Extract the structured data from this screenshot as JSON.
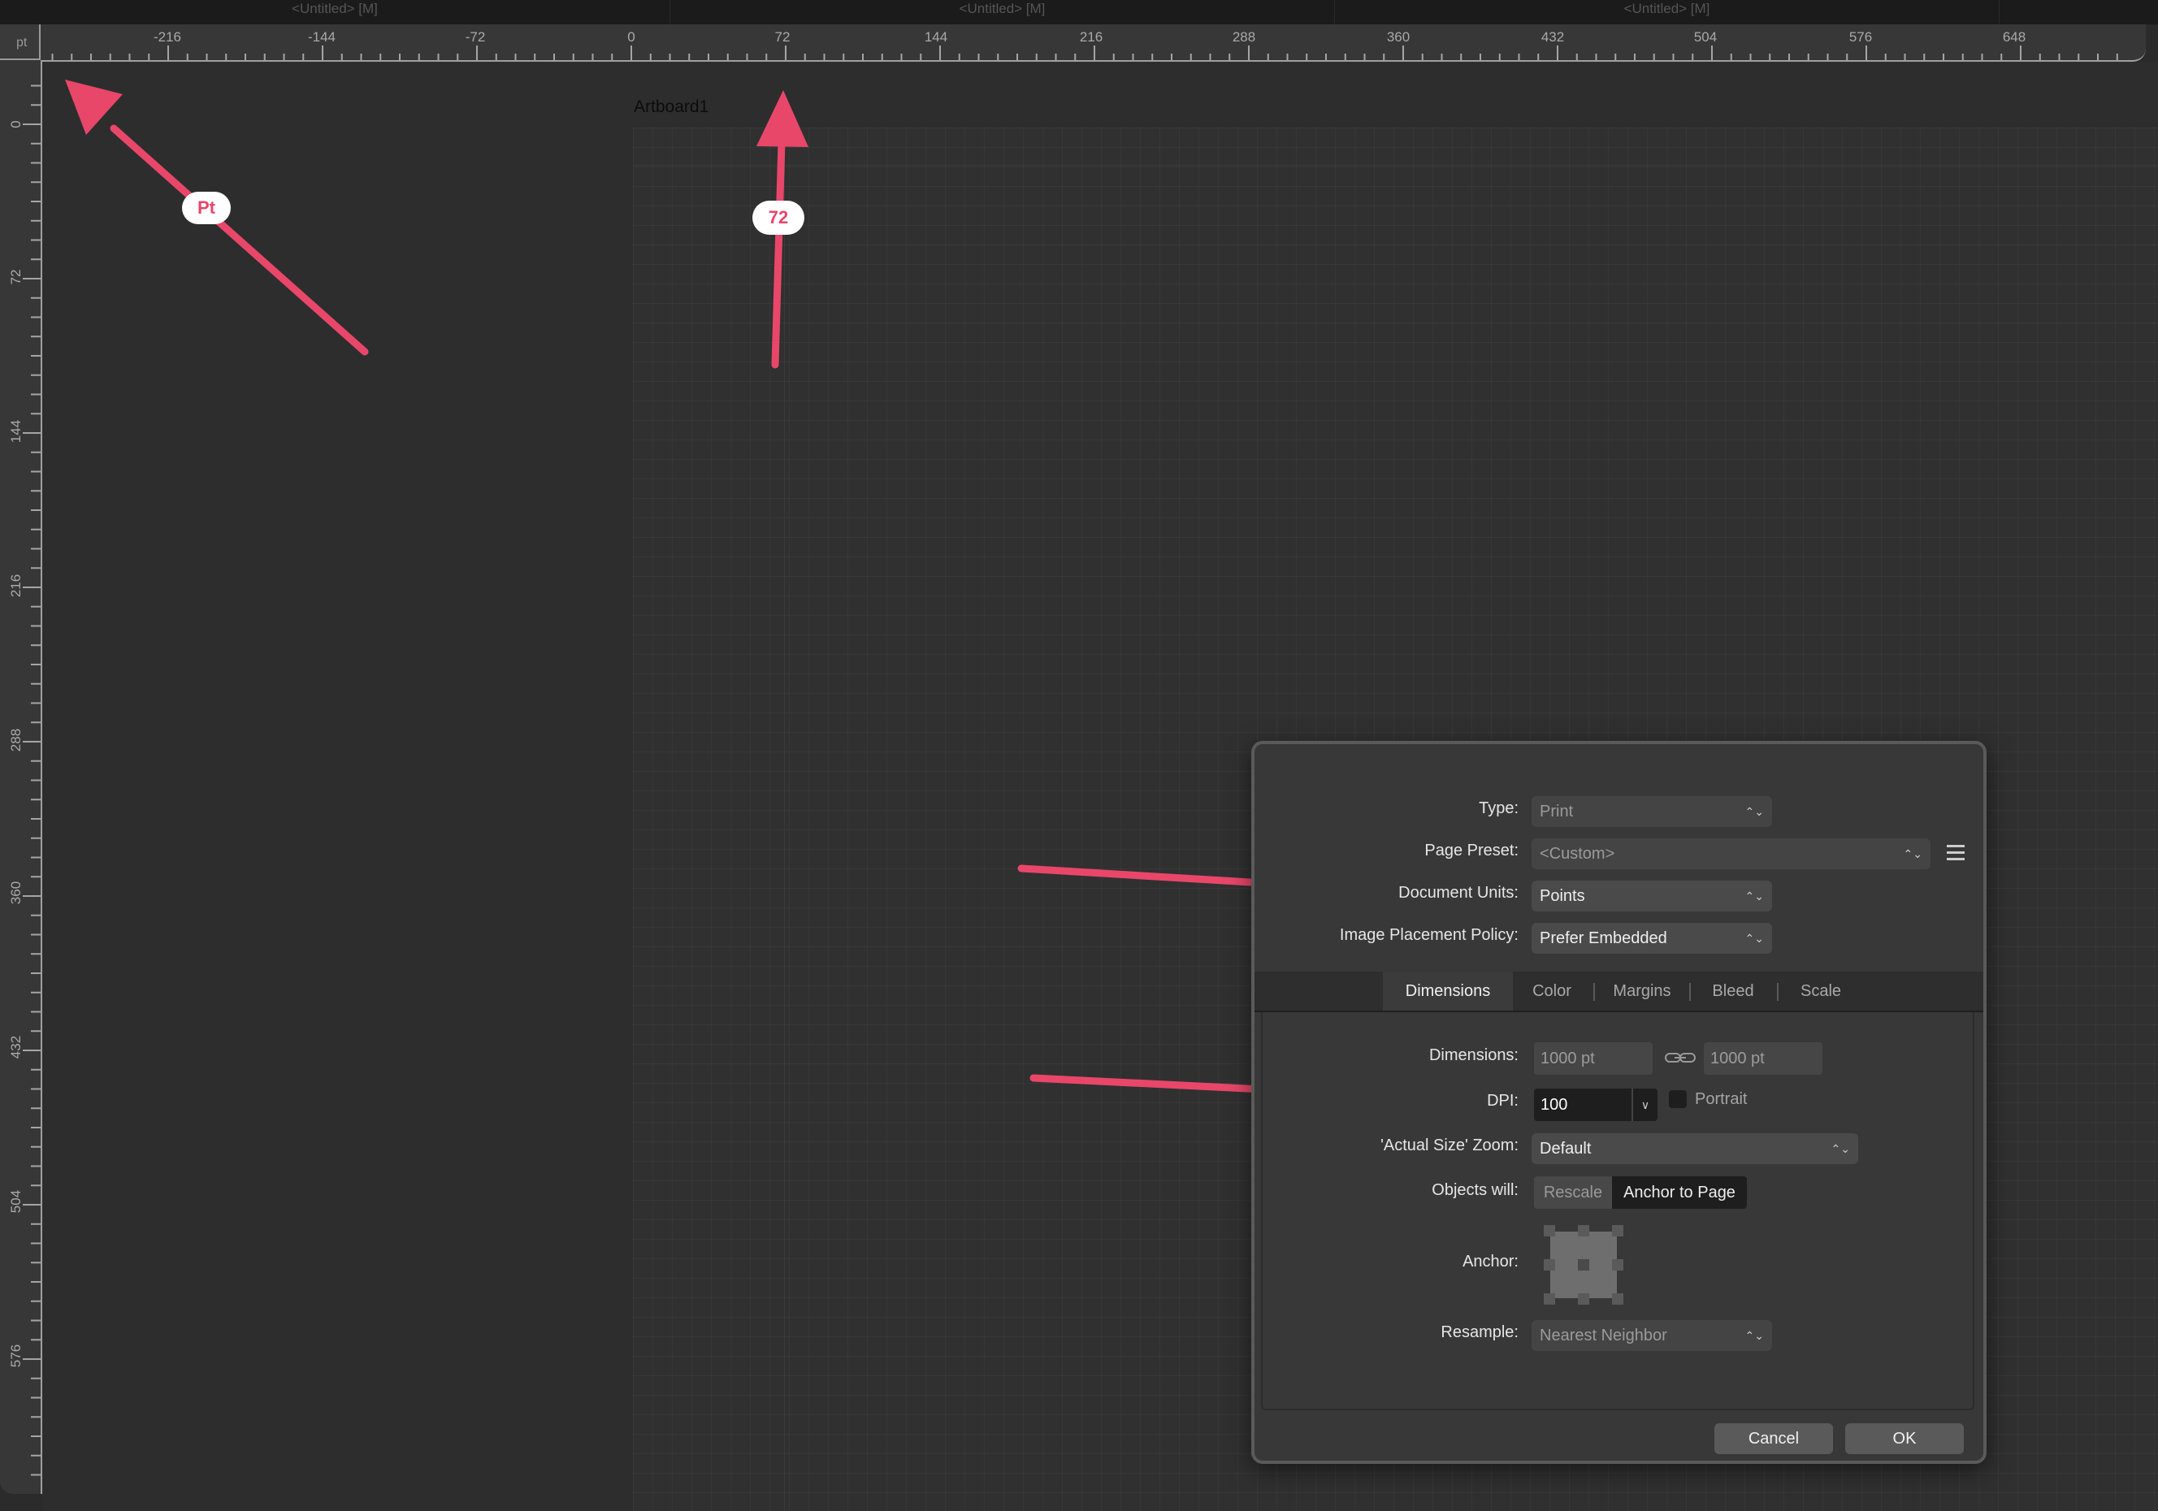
{
  "document_tabs": [
    "<Untitled> [M]",
    "<Untitled> [M]",
    "<Untitled> [M]"
  ],
  "ruler": {
    "unit": "pt",
    "horizontal_ticks": [
      "-216",
      "-144",
      "-72",
      "0",
      "72",
      "144",
      "216",
      "288",
      "360",
      "432",
      "504",
      "576",
      "648"
    ],
    "vertical_ticks": [
      "0",
      "72",
      "144",
      "216",
      "288",
      "360",
      "432",
      "504",
      "576"
    ]
  },
  "canvas": {
    "artboard_name": "Artboard1"
  },
  "annotations": {
    "pt_badge": "Pt",
    "seventy_two_badge": "72",
    "arrow_color": "#e8476a"
  },
  "dialog": {
    "type_label": "Type:",
    "type_value": "Print",
    "page_preset_label": "Page Preset:",
    "page_preset_value": "<Custom>",
    "document_units_label": "Document Units:",
    "document_units_value": "Points",
    "image_placement_label": "Image Placement Policy:",
    "image_placement_value": "Prefer Embedded",
    "tabs": [
      "Dimensions",
      "Color",
      "Margins",
      "Bleed",
      "Scale"
    ],
    "active_tab": "Dimensions",
    "dimensions_label": "Dimensions:",
    "width_value": "1000 pt",
    "height_value": "1000 pt",
    "dpi_label": "DPI:",
    "dpi_value": "100",
    "portrait_label": "Portrait",
    "portrait_checked": false,
    "actual_size_zoom_label": "'Actual Size' Zoom:",
    "actual_size_zoom_value": "Default",
    "objects_will_label": "Objects will:",
    "objects_will_options": [
      "Rescale",
      "Anchor to Page"
    ],
    "objects_will_selected": "Anchor to Page",
    "anchor_label": "Anchor:",
    "resample_label": "Resample:",
    "resample_value": "Nearest Neighbor",
    "cancel_label": "Cancel",
    "ok_label": "OK"
  }
}
